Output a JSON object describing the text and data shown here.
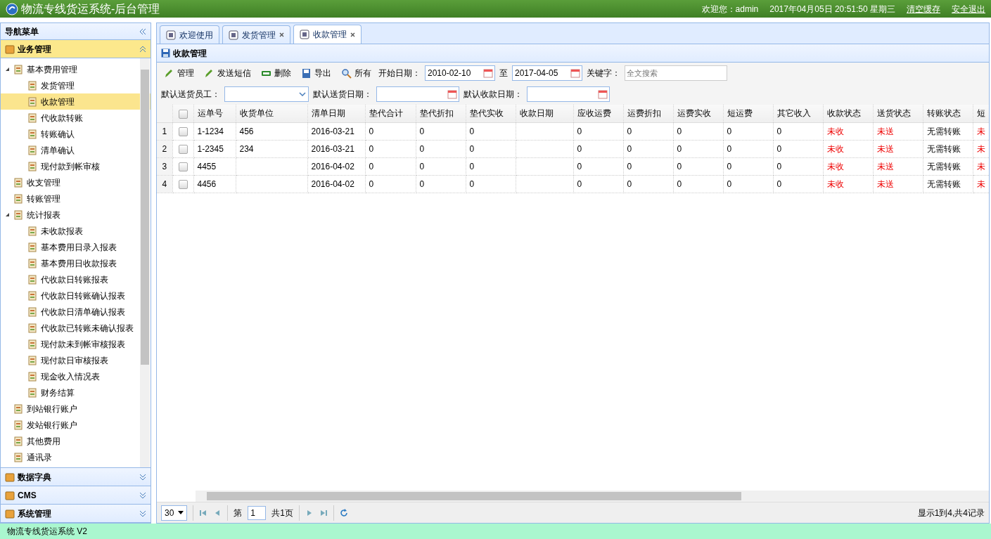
{
  "header": {
    "title": "物流专线货运系统-后台管理",
    "welcome": "欢迎您：admin",
    "datetime": "2017年04月05日 20:51:50 星期三",
    "links": [
      "清空缓存",
      "安全退出"
    ]
  },
  "sidebar": {
    "title": "导航菜单",
    "panels": [
      {
        "title": "业务管理",
        "expanded": true,
        "tree": [
          {
            "label": "基本费用管理",
            "expanded": true,
            "selected": false,
            "children": [
              {
                "label": "发货管理",
                "selected": false
              },
              {
                "label": "收款管理",
                "selected": true
              },
              {
                "label": "代收款转账",
                "selected": false
              },
              {
                "label": "转账确认",
                "selected": false
              },
              {
                "label": "清单确认",
                "selected": false
              },
              {
                "label": "现付款到帐审核",
                "selected": false
              }
            ]
          },
          {
            "label": "收支管理",
            "selected": false
          },
          {
            "label": "转账管理",
            "selected": false
          },
          {
            "label": "统计报表",
            "expanded": true,
            "selected": false,
            "children": [
              {
                "label": "未收款报表",
                "selected": false
              },
              {
                "label": "基本费用日录入报表",
                "selected": false
              },
              {
                "label": "基本费用日收款报表",
                "selected": false
              },
              {
                "label": "代收款日转账报表",
                "selected": false
              },
              {
                "label": "代收款日转账确认报表",
                "selected": false
              },
              {
                "label": "代收款日清单确认报表",
                "selected": false
              },
              {
                "label": "代收款已转账未确认报表",
                "selected": false
              },
              {
                "label": "现付款未到帐审核报表",
                "selected": false
              },
              {
                "label": "现付款日审核报表",
                "selected": false
              },
              {
                "label": "现金收入情况表",
                "selected": false
              },
              {
                "label": "财务结算",
                "selected": false
              }
            ]
          },
          {
            "label": "到站银行账户",
            "selected": false
          },
          {
            "label": "发站银行账户",
            "selected": false
          },
          {
            "label": "其他费用",
            "selected": false
          },
          {
            "label": "通讯录",
            "selected": false
          }
        ]
      },
      {
        "title": "数据字典",
        "expanded": false
      },
      {
        "title": "CMS",
        "expanded": false
      },
      {
        "title": "系统管理",
        "expanded": false
      }
    ]
  },
  "tabs": [
    {
      "label": "欢迎使用",
      "closable": false,
      "selected": false
    },
    {
      "label": "发货管理",
      "closable": true,
      "selected": false
    },
    {
      "label": "收款管理",
      "closable": true,
      "selected": true
    }
  ],
  "panel_title": "收款管理",
  "toolbar": [
    {
      "kind": "edit",
      "label": "管理"
    },
    {
      "kind": "edit",
      "label": "发送短信"
    },
    {
      "kind": "delete",
      "label": "删除"
    },
    {
      "kind": "export",
      "label": "导出"
    },
    {
      "kind": "search",
      "label": "所有"
    }
  ],
  "filters": {
    "start_label": "开始日期：",
    "start_value": "2010-02-10",
    "to_label": "至",
    "end_value": "2017-04-05",
    "keyword_label": "关键字：",
    "keyword_placeholder": "全文搜索",
    "staff_label": "默认送货员工：",
    "delivery_date_label": "默认送货日期：",
    "payment_date_label": "默认收款日期："
  },
  "table": {
    "select_all_checked": false,
    "columns": [
      {
        "label": "运单号",
        "kind": "text"
      },
      {
        "label": "收货单位",
        "kind": "text"
      },
      {
        "label": "清单日期",
        "kind": "text"
      },
      {
        "label": "垫代合计",
        "kind": "text"
      },
      {
        "label": "垫代折扣",
        "kind": "text"
      },
      {
        "label": "垫代实收",
        "kind": "text"
      },
      {
        "label": "收款日期",
        "kind": "text"
      },
      {
        "label": "应收运费",
        "kind": "text"
      },
      {
        "label": "运费折扣",
        "kind": "text"
      },
      {
        "label": "运费实收",
        "kind": "text"
      },
      {
        "label": "短运费",
        "kind": "text"
      },
      {
        "label": "其它收入",
        "kind": "text"
      },
      {
        "label": "收款状态",
        "kind": "status"
      },
      {
        "label": "送货状态",
        "kind": "status"
      },
      {
        "label": "转账状态",
        "kind": "text"
      },
      {
        "label": "短",
        "kind": "status"
      }
    ],
    "rows": [
      {
        "number": "1",
        "checked": false,
        "cells": [
          "1-1234",
          "456",
          "2016-03-21",
          "0",
          "0",
          "0",
          "",
          "0",
          "0",
          "0",
          "0",
          "0",
          "未收",
          "未送",
          "无需转账",
          "未"
        ]
      },
      {
        "number": "2",
        "checked": false,
        "cells": [
          "1-2345",
          "234",
          "2016-03-21",
          "0",
          "0",
          "0",
          "",
          "0",
          "0",
          "0",
          "0",
          "0",
          "未收",
          "未送",
          "无需转账",
          "未"
        ]
      },
      {
        "number": "3",
        "checked": false,
        "cells": [
          "4455",
          "",
          "2016-04-02",
          "0",
          "0",
          "0",
          "",
          "0",
          "0",
          "0",
          "0",
          "0",
          "未收",
          "未送",
          "无需转账",
          "未"
        ]
      },
      {
        "number": "4",
        "checked": false,
        "cells": [
          "4456",
          "",
          "2016-04-02",
          "0",
          "0",
          "0",
          "",
          "0",
          "0",
          "0",
          "0",
          "0",
          "未收",
          "未送",
          "无需转账",
          "未"
        ]
      }
    ]
  },
  "pager": {
    "page_size": "30",
    "page_label": "第",
    "page": "1",
    "total_pages": "共1页",
    "summary": "显示1到4,共4记录"
  },
  "status_bar": "物流专线货运系统 V2"
}
